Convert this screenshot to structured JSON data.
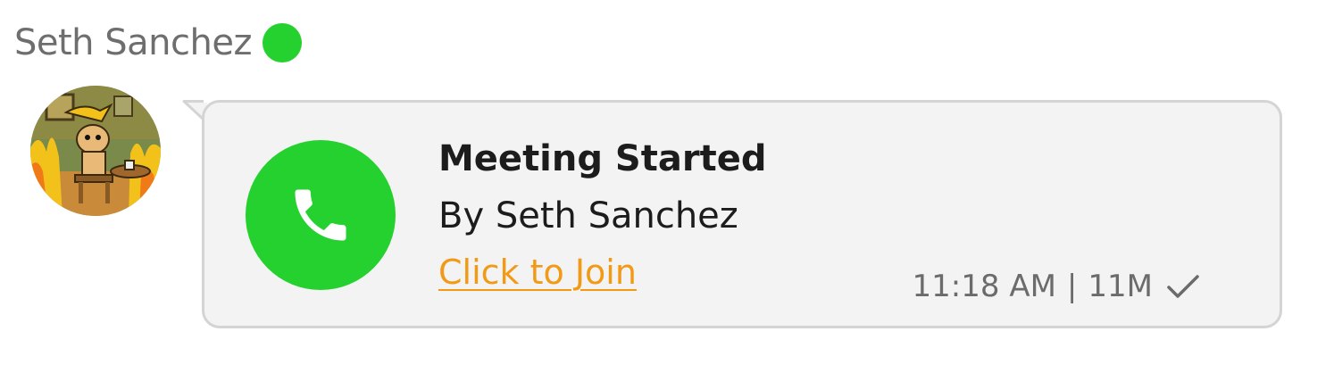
{
  "sender": {
    "name": "Seth Sanchez",
    "status_color": "#24d12e"
  },
  "avatar": {
    "description_icon": "avatar-illustration"
  },
  "message": {
    "icon": "phone-icon",
    "icon_bg_color": "#24d12e",
    "title": "Meeting Started",
    "subtitle": "By Seth Sanchez",
    "link_label": "Click to Join",
    "link_color": "#f29a16",
    "time": "11:18 AM",
    "separator": "|",
    "size": "11M",
    "status_icon": "checkmark-icon"
  }
}
